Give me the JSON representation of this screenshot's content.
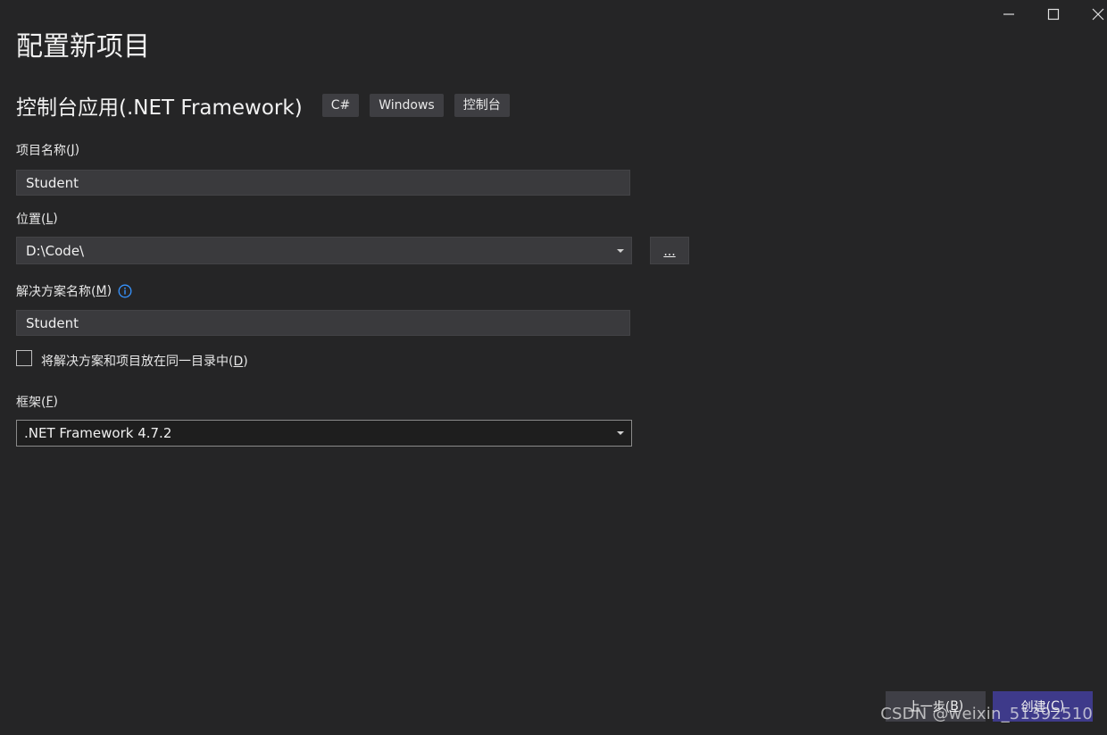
{
  "window": {
    "minimize_icon": "minimize-icon",
    "maximize_icon": "maximize-icon",
    "close_icon": "close-icon"
  },
  "page_title": "配置新项目",
  "template": {
    "name": "控制台应用(.NET Framework)",
    "tags": [
      "C#",
      "Windows",
      "控制台"
    ]
  },
  "project_name": {
    "label": "项目名称(",
    "access_key": "J",
    "label_end": ")",
    "value": "Student"
  },
  "location": {
    "label": "位置(",
    "access_key": "L",
    "label_end": ")",
    "value": "D:\\Code\\",
    "browse_label": "..."
  },
  "solution_name": {
    "label": "解决方案名称(",
    "access_key": "M",
    "label_end": ")",
    "info_icon": "info-icon",
    "value": "Student"
  },
  "same_directory": {
    "label": "将解决方案和项目放在同一目录中(",
    "access_key": "D",
    "label_end": ")",
    "checked": false
  },
  "framework": {
    "label": "框架(",
    "access_key": "F",
    "label_end": ")",
    "value": ".NET Framework 4.7.2"
  },
  "footer": {
    "back": {
      "label": "上一步(",
      "access_key": "B",
      "label_end": ")"
    },
    "create": {
      "label": "创建(",
      "access_key": "C",
      "label_end": ")"
    }
  },
  "watermark": "CSDN @weixin_51392510",
  "colors": {
    "background": "#252526",
    "input_background": "#3a3a3d",
    "tag_background": "#3e3e42",
    "primary_button": "#3e3a8a",
    "info_icon": "#3794ff"
  }
}
